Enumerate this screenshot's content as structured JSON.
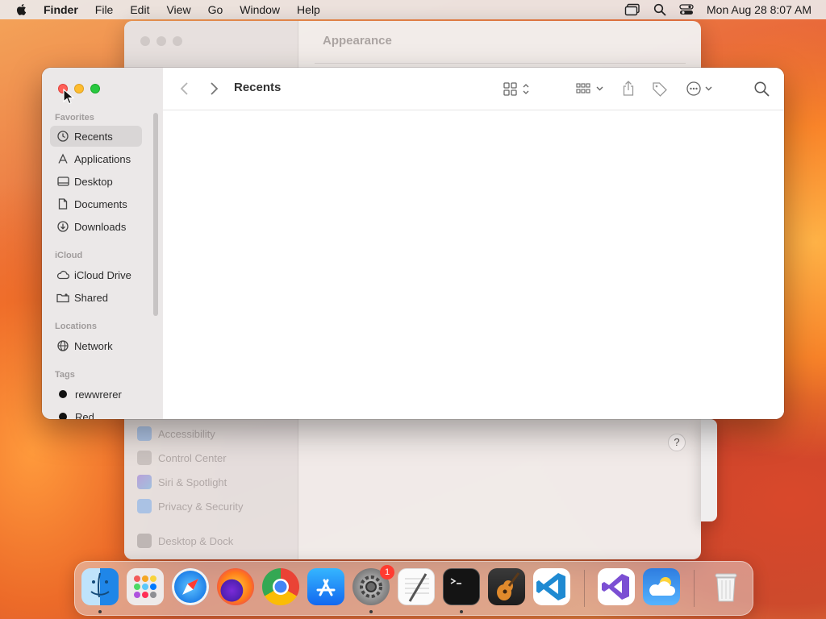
{
  "menubar": {
    "app_name": "Finder",
    "menus": [
      "File",
      "Edit",
      "View",
      "Go",
      "Window",
      "Help"
    ],
    "clock": "Mon Aug 28  8:07 AM"
  },
  "background_window": {
    "title": "Appearance",
    "sidebar_items": [
      "Accessibility",
      "Control Center",
      "Siri & Spotlight",
      "Privacy & Security",
      "Desktop & Dock"
    ],
    "help_label": "?"
  },
  "finder": {
    "title": "Recents",
    "sections": {
      "favorites": "Favorites",
      "icloud": "iCloud",
      "locations": "Locations",
      "tags": "Tags"
    },
    "favorites": [
      {
        "label": "Recents",
        "icon": "clock-icon",
        "selected": true
      },
      {
        "label": "Applications",
        "icon": "applications-icon"
      },
      {
        "label": "Desktop",
        "icon": "desktop-icon"
      },
      {
        "label": "Documents",
        "icon": "document-icon"
      },
      {
        "label": "Downloads",
        "icon": "download-icon"
      }
    ],
    "icloud": [
      {
        "label": "iCloud Drive",
        "icon": "cloud-icon"
      },
      {
        "label": "Shared",
        "icon": "shared-folder-icon"
      }
    ],
    "locations": [
      {
        "label": "Network",
        "icon": "globe-icon"
      }
    ],
    "tags": [
      {
        "label": "rewwrerer",
        "color": "#111111"
      },
      {
        "label": "Red",
        "color": "#111111"
      }
    ]
  },
  "dock": {
    "apps": [
      "Finder",
      "Launchpad",
      "Safari",
      "Firefox",
      "Google Chrome",
      "App Store",
      "System Settings",
      "TextEdit",
      "Terminal",
      "GarageBand",
      "Visual Studio Code",
      "Visual Studio",
      "Weather",
      "Trash"
    ],
    "settings_badge": "1"
  },
  "colors": {
    "close": "#ff5f57",
    "minimize": "#febc2e",
    "zoom": "#28c840",
    "selection": "#d9d6d6"
  }
}
